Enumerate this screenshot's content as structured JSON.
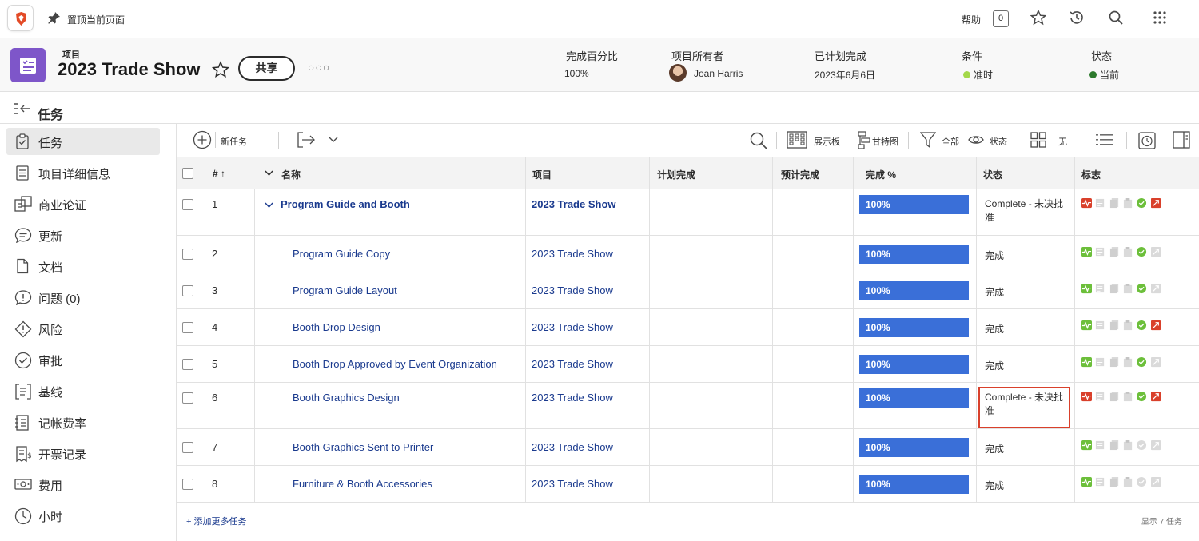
{
  "topbar": {
    "pin_label": "置顶当前页面",
    "help_label": "帮助",
    "notification_count": "0"
  },
  "project": {
    "type_label": "项目",
    "title": "2023 Trade Show",
    "share_label": "共享",
    "more_label": "○○○",
    "fields": {
      "percent_label": "完成百分比",
      "percent_value": "100%",
      "owner_label": "项目所有者",
      "owner_value": "Joan Harris",
      "planned_label": "已计划完成",
      "planned_value": "2023年6月6日",
      "condition_label": "条件",
      "condition_value": "准时",
      "status_label": "状态",
      "status_value": "当前"
    },
    "colors": {
      "icon_bg": "#7e56c9",
      "condition_dot": "#a3d84a",
      "status_dot": "#2d7a2d"
    }
  },
  "section": {
    "title": "任务"
  },
  "sidebar": {
    "items": [
      {
        "label": "任务",
        "icon": "clipboard-check-icon",
        "active": true
      },
      {
        "label": "项目详细信息",
        "icon": "document-lines-icon"
      },
      {
        "label": "商业论证",
        "icon": "business-case-icon"
      },
      {
        "label": "更新",
        "icon": "chat-bubble-icon"
      },
      {
        "label": "文档",
        "icon": "file-icon"
      },
      {
        "label": "问题 (0)",
        "icon": "issue-bubble-icon"
      },
      {
        "label": "风险",
        "icon": "risk-diamond-icon"
      },
      {
        "label": "审批",
        "icon": "approval-check-icon"
      },
      {
        "label": "基线",
        "icon": "baseline-bracket-icon"
      },
      {
        "label": "记帐费率",
        "icon": "billing-rates-icon"
      },
      {
        "label": "开票记录",
        "icon": "invoice-records-icon"
      },
      {
        "label": "费用",
        "icon": "expense-money-icon"
      },
      {
        "label": "小时",
        "icon": "clock-icon"
      }
    ]
  },
  "toolbar": {
    "new_task": "新任务",
    "board": "展示板",
    "gantt": "甘特图",
    "filter": "全部",
    "view": "状态",
    "group": "无"
  },
  "table": {
    "headers": {
      "num": "# ↑",
      "name": "名称",
      "project": "项目",
      "planned": "计划完成",
      "projected": "预计完成",
      "percent": "完成 %",
      "status": "状态",
      "flags": "标志"
    },
    "rows": [
      {
        "num": "1",
        "name": "Program Guide and Booth",
        "project": "2023 Trade Show",
        "percent": "100%",
        "status": "Complete - 未决批准",
        "parent": true,
        "health": "red",
        "done": true,
        "late": true
      },
      {
        "num": "2",
        "name": "Program Guide Copy",
        "project": "2023 Trade Show",
        "percent": "100%",
        "status": "完成",
        "health": "green",
        "done": true,
        "late": false
      },
      {
        "num": "3",
        "name": "Program Guide Layout",
        "project": "2023 Trade Show",
        "percent": "100%",
        "status": "完成",
        "health": "green",
        "done": true,
        "late": false
      },
      {
        "num": "4",
        "name": "Booth Drop Design",
        "project": "2023 Trade Show",
        "percent": "100%",
        "status": "完成",
        "health": "green",
        "done": true,
        "late": true
      },
      {
        "num": "5",
        "name": "Booth Drop Approved by Event Organization",
        "project": "2023 Trade Show",
        "percent": "100%",
        "status": "完成",
        "health": "green",
        "done": true,
        "late": false
      },
      {
        "num": "6",
        "name": "Booth Graphics Design",
        "project": "2023 Trade Show",
        "percent": "100%",
        "status": "Complete - 未决批准",
        "health": "red",
        "done": true,
        "late": true,
        "highlight": true
      },
      {
        "num": "7",
        "name": "Booth Graphics Sent to Printer",
        "project": "2023 Trade Show",
        "percent": "100%",
        "status": "完成",
        "health": "green",
        "done": false,
        "late": false
      },
      {
        "num": "8",
        "name": "Furniture & Booth Accessories",
        "project": "2023 Trade Show",
        "percent": "100%",
        "status": "完成",
        "health": "green",
        "done": false,
        "late": false
      }
    ]
  },
  "footer": {
    "add_more": "+ 添加更多任务",
    "shown_count": "显示 7 任务"
  }
}
